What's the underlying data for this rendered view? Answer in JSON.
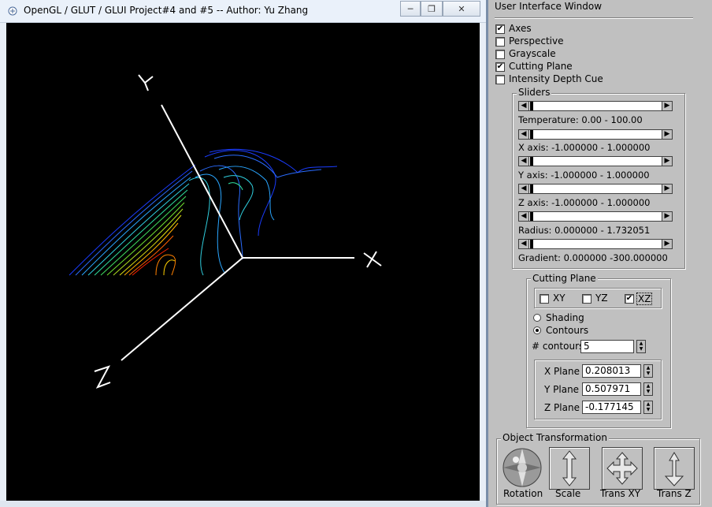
{
  "window": {
    "title": "OpenGL / GLUT / GLUI Project#4 and #5 -- Author: Yu Zhang",
    "controls": [
      "minimize",
      "maximize",
      "close"
    ]
  },
  "scene": {
    "axis_labels": {
      "x": "X",
      "y": "Y",
      "z": "Z"
    }
  },
  "ui": {
    "title": "User Interface Window",
    "options": [
      {
        "label": "Axes",
        "checked": true
      },
      {
        "label": "Perspective",
        "checked": false
      },
      {
        "label": "Grayscale",
        "checked": false
      },
      {
        "label": "Cutting Plane",
        "checked": true
      },
      {
        "label": "Intensity Depth Cue",
        "checked": false
      }
    ],
    "sliders_title": "Sliders",
    "sliders": [
      {
        "label": "Temperature:  0.00 - 100.00",
        "value": 0
      },
      {
        "label": "X axis: -1.000000 - 1.000000",
        "value": 0
      },
      {
        "label": "Y axis: -1.000000 - 1.000000",
        "value": 0
      },
      {
        "label": "Z axis: -1.000000 - 1.000000",
        "value": 0
      },
      {
        "label": "Radius: 0.000000 - 1.732051",
        "value": 0
      },
      {
        "label": "Gradient: 0.000000 -300.000000",
        "value": 0
      }
    ],
    "cutting_plane": {
      "title": "Cutting Plane",
      "planes": [
        {
          "label": "XY",
          "checked": false
        },
        {
          "label": "YZ",
          "checked": false
        },
        {
          "label": "XZ",
          "checked": true
        }
      ],
      "modes": [
        {
          "label": "Shading",
          "selected": false
        },
        {
          "label": "Contours",
          "selected": true
        }
      ],
      "contours_label": "# contours",
      "contours_value": "5",
      "x_plane_label": "X Plane",
      "x_plane_value": "0.208013",
      "y_plane_label": "Y Plane",
      "y_plane_value": "0.507971",
      "z_plane_label": "Z Plane",
      "z_plane_value": "-0.177145"
    },
    "transform": {
      "title": "Object Transformation",
      "buttons": [
        {
          "label": "Rotation"
        },
        {
          "label": "Scale"
        },
        {
          "label": "Trans XY"
        },
        {
          "label": "Trans Z"
        }
      ]
    }
  }
}
